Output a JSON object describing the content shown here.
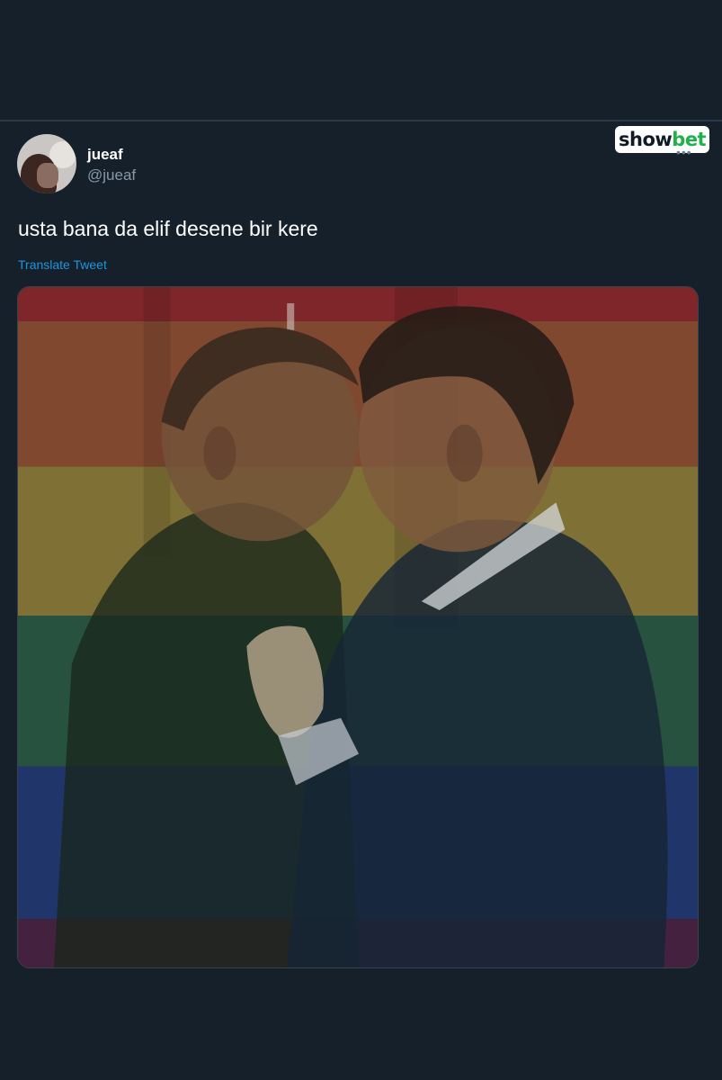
{
  "tweet": {
    "display_name": "jueaf",
    "handle": "@jueaf",
    "text": "usta bana da elif desene bir kere",
    "translate_label": "Translate Tweet",
    "more_icon": "more-dots-icon"
  },
  "watermark": {
    "part1": "show",
    "part2": "bet"
  },
  "colors": {
    "background": "#15202b",
    "link": "#1b95e0",
    "brand_green": "#1fb14a"
  }
}
